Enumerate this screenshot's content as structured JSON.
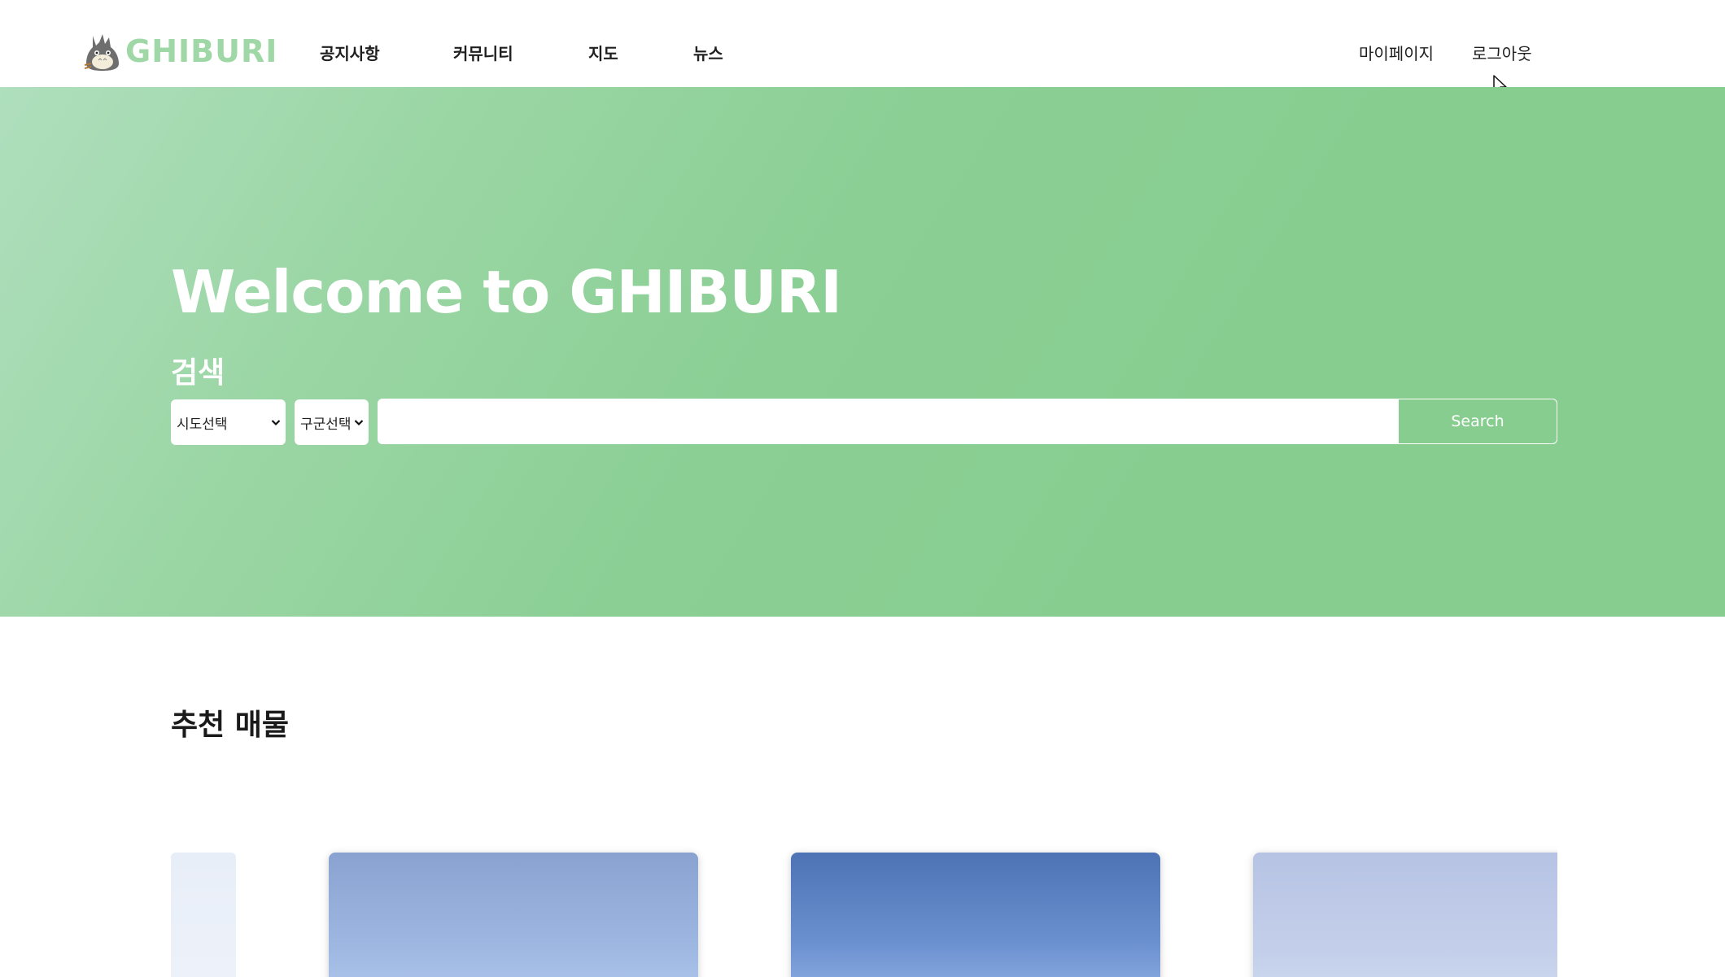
{
  "header": {
    "logo_text": "GHIBURI",
    "logo_icon": "totoro-icon",
    "nav": [
      {
        "label": "공지사항"
      },
      {
        "label": "커뮤니티"
      },
      {
        "label": "지도"
      },
      {
        "label": "뉴스"
      }
    ],
    "user_menu": {
      "mypage_label": "마이페이지",
      "logout_label": "로그아웃"
    }
  },
  "hero": {
    "title": "Welcome to GHIBURI",
    "search_heading": "검색",
    "sido_select": {
      "selected": "시도선택"
    },
    "gugun_select": {
      "selected": "구군선택"
    },
    "search_input": {
      "value": "",
      "placeholder": ""
    },
    "search_button_label": "Search"
  },
  "recommended": {
    "title": "추천 매물",
    "cards": [
      {
        "image": "building-photo-icon"
      },
      {
        "image": "building-photo-icon"
      },
      {
        "image": "building-photo-icon"
      }
    ]
  },
  "colors": {
    "brand_green": "#88cd90",
    "logo_green": "#9fd8a6",
    "text_dark": "#1f1f1f"
  }
}
